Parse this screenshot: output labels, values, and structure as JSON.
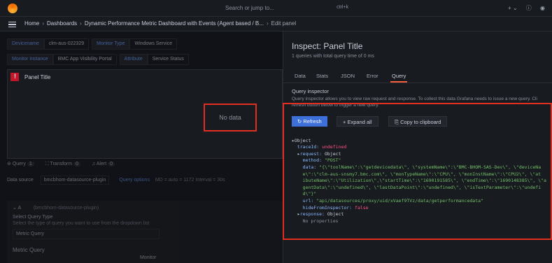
{
  "topbar": {
    "search_placeholder": "Search or jump to...",
    "shortcut": "ctrl+k",
    "icons": [
      "plus-icon",
      "help-icon",
      "rss-icon"
    ]
  },
  "breadcrumbs": [
    "Home",
    "Dashboards",
    "Dynamic Performance Metric Dashboard with Events (Agent based / B...",
    "Edit panel"
  ],
  "variables": [
    [
      {
        "label": "Devicename",
        "value": "clm-aus-022329"
      },
      {
        "label": "Monitor Type",
        "value": "Windows Service"
      }
    ],
    [
      {
        "label": "Monitor Instance",
        "value": "BMC App Visibility Portal"
      },
      {
        "label": "Attribute",
        "value": "Service Status"
      }
    ]
  ],
  "panel": {
    "title": "Panel Title",
    "no_data": "No data"
  },
  "editor_tabs": [
    {
      "label": "Query",
      "count": "1"
    },
    {
      "label": "Transform",
      "count": "0"
    },
    {
      "label": "Alert",
      "count": "0"
    }
  ],
  "datasource": {
    "label": "Data source",
    "name": "bmcbhom-datasource-plugin",
    "options": "Query options",
    "meta": "MD = auto = 1172   Interval = 30s"
  },
  "query_editor": {
    "ref": "A",
    "ds": "(bmcbhom-datasource-plugin)",
    "type_label": "Select Query Type",
    "type_desc": "Select the type of query you want to use from the dropdown list",
    "type_value": "Metric Query",
    "metric_label": "Metric Query",
    "monitor": "Monitor"
  },
  "inspect": {
    "title": "Inspect: Panel Title",
    "subtitle": "1 queries with total query time of 0 ms",
    "tabs": [
      "Data",
      "Stats",
      "JSON",
      "Error",
      "Query"
    ],
    "active_tab": "Query",
    "qi_label": "Query inspector",
    "qi_desc_1": "Query inspector allows you to view raw request and response. To collect this data Grafana needs to issue a new query. Cli",
    "qi_desc_2": "refresh button below to trigger a new query.",
    "buttons": {
      "refresh": "Refresh",
      "expand": "+ Expand all",
      "copy": "Copy to clipboard"
    }
  },
  "tree": {
    "root": "Object",
    "traceId_key": "traceId:",
    "traceId_val": "undefined",
    "request_key": "request:",
    "request_val": "Object",
    "method_key": "method:",
    "method_val": "\"POST\"",
    "data_key": "data:",
    "data_lines": [
      "\"{\\\"toolName\\\":\\\"getdevicedata\\\", \\\"systemName\\\":\\\"BMC-BHOM-SAS-Dev\\\", \\\"deviceNa",
      "e\\\":\\\"clm-aus-snsmy7.bmc.com\\\", \\\"monTypeName\\\":\\\"CPU\\\", \\\"monInstName\\\":\\\"CPU2\\\", \\\"at",
      "ibuteName\\\":\\\"Utilization\\\",\\\"startTime\\\":\\\"1690191585\\\", \\\"endTime\\\":\\\"1690148385\\\", \\\"a",
      "gentData\\\":\\\"undefined\\\", \\\"lastDataPoint\\\":\\\"undefined\\\", \\\"isTextParameter\\\":\\\"undefi",
      "d\\\"}\""
    ],
    "url_key": "url:",
    "url_val": "\"api/datasources/proxy/uid/xVaef9TVz/data/getperformancedata\"",
    "hide_key": "hideFromInspector:",
    "hide_val": "false",
    "response_key": "response:",
    "response_val": "Object",
    "no_props": "No properties"
  },
  "colors": {
    "accent": "#3d71d9",
    "highlight": "#e02f20",
    "tab_active": "#f55f3e"
  }
}
